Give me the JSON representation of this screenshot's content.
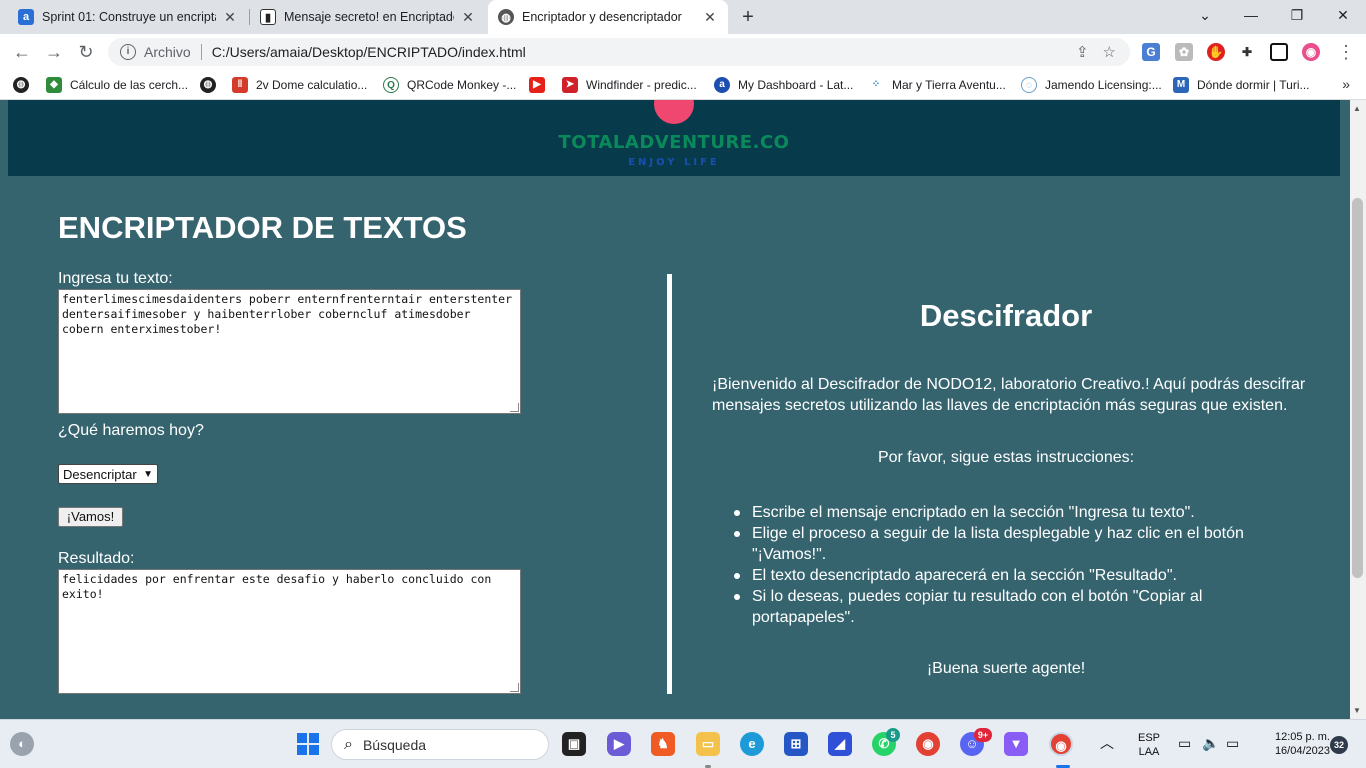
{
  "browser": {
    "tabs": [
      {
        "title": "Sprint 01: Construye un encriptac",
        "favicon": "alura-icon",
        "active": false
      },
      {
        "title": "Mensaje secreto! en Encriptador",
        "favicon": "codepen-icon",
        "active": false
      },
      {
        "title": "Encriptador y desencriptador",
        "favicon": "globe-icon",
        "active": true
      }
    ],
    "address": {
      "scheme_label": "Archivo",
      "url": "C:/Users/amaia/Desktop/ENCRIPTADO/index.html"
    },
    "bookmarks": [
      {
        "label": "",
        "icon": "globe-icon"
      },
      {
        "label": "Cálculo de las cerch...",
        "icon": "green-icon"
      },
      {
        "label": "",
        "icon": "globe-icon"
      },
      {
        "label": "2v Dome calculatio...",
        "icon": "red-bars-icon"
      },
      {
        "label": "QRCode Monkey -...",
        "icon": "monkey-icon"
      },
      {
        "label": "",
        "icon": "youtube-icon"
      },
      {
        "label": "Windfinder - predic...",
        "icon": "windfinder-icon"
      },
      {
        "label": "My Dashboard - Lat...",
        "icon": "a-icon"
      },
      {
        "label": "Mar y Tierra Aventu...",
        "icon": "dots-icon"
      },
      {
        "label": "Jamendo Licensing:...",
        "icon": "jamendo-icon"
      },
      {
        "label": "Dónde dormir | Turi...",
        "icon": "m-icon"
      }
    ]
  },
  "page": {
    "logo_text": "TOTALADVENTURE.CO",
    "logo_sub": "ENJOY LIFE",
    "title": "ENCRIPTADOR DE TEXTOS",
    "input_label": "Ingresa tu texto:",
    "input_value": "fenterlimescimesdaidenters poberr enternfrenterntair enterstenter dentersaifimesober y haibenterrlober coberncluf atimesdober cobern enterximestober!",
    "question_label": "¿Qué haremos hoy?",
    "select_value": "Desencriptar",
    "submit_label": "¡Vamos!",
    "result_label": "Resultado:",
    "result_value": "felicidades por enfrentar este desafio y haberlo concluido con exito!",
    "side_title": "Descifrador",
    "welcome": "¡Bienvenido al Descifrador de NODO12, laboratorio Creativo.! Aquí podrás descifrar mensajes secretos utilizando las llaves de encriptación más seguras que existen.",
    "please": "Por favor, sigue estas instrucciones:",
    "steps": [
      "Escribe el mensaje encriptado en la sección \"Ingresa tu texto\".",
      "Elige el proceso a seguir de la lista desplegable y haz clic en el botón \"¡Vamos!\".",
      "El texto desencriptado aparecerá en la sección \"Resultado\".",
      "Si lo deseas, puedes copiar tu resultado con el botón \"Copiar al portapapeles\"."
    ],
    "luck": "¡Buena suerte agente!"
  },
  "taskbar": {
    "search_placeholder": "Búsqueda",
    "whatsapp_badge": "5",
    "discord_badge": "9+",
    "lang": "ESP",
    "lang_sub": "LAA",
    "time": "12:05 p. m.",
    "date": "16/04/2023",
    "notif_count": "32"
  },
  "colors": {
    "page_bg": "#35646f",
    "banner_bg": "#073b4c",
    "logo_accent": "#ef476f"
  }
}
